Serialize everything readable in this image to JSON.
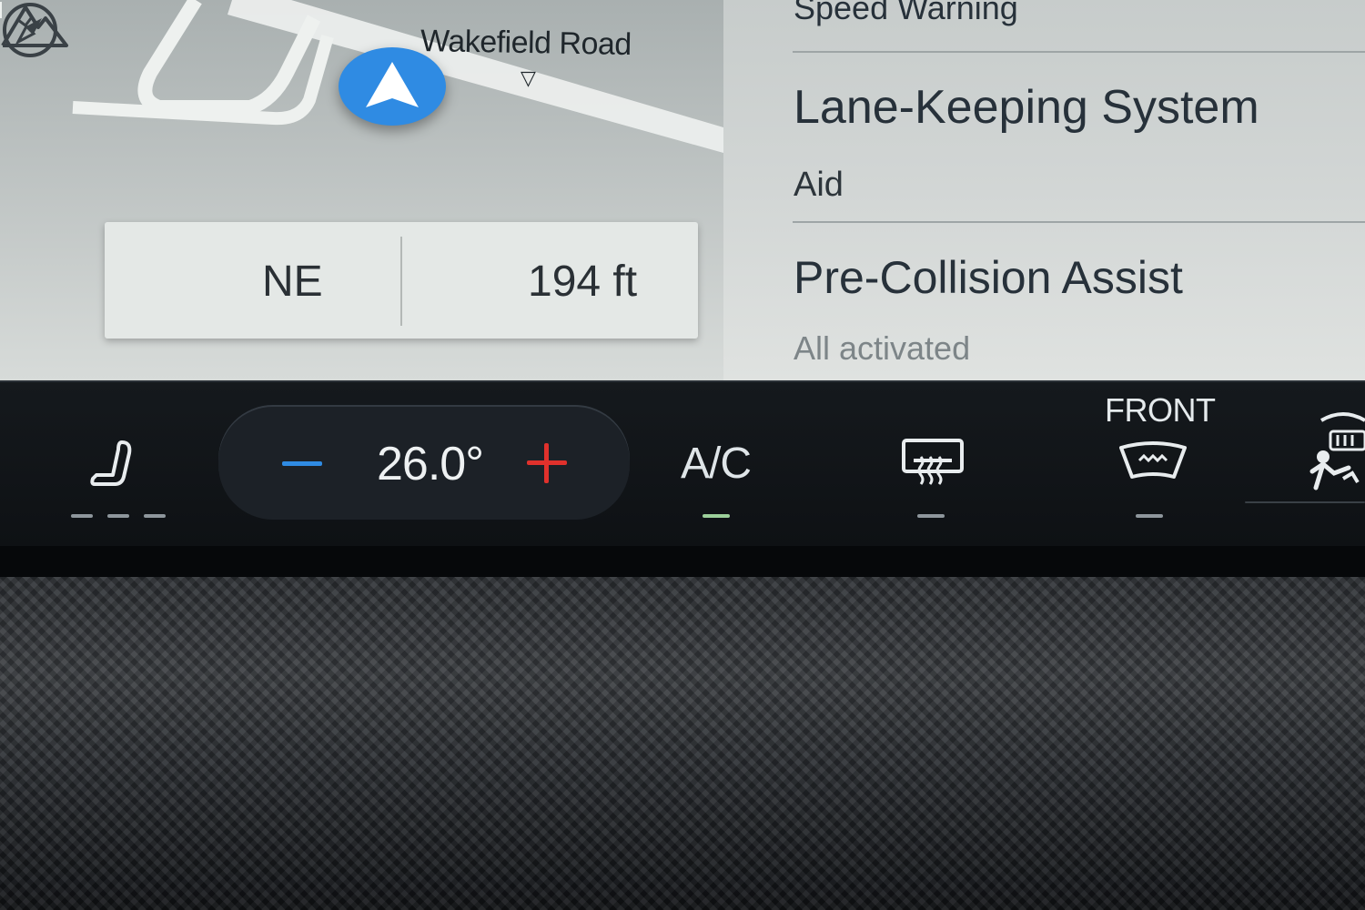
{
  "map": {
    "street_name": "Wakefield Road",
    "street_pointer": "▽",
    "heading": "NE",
    "elevation": "194 ft"
  },
  "settings": {
    "items": [
      {
        "title": "Speed Warning",
        "subtitle": ""
      },
      {
        "title": "Lane-Keeping System",
        "subtitle": "Aid"
      },
      {
        "title": "Pre-Collision Assist",
        "subtitle": "All activated"
      }
    ]
  },
  "climate": {
    "decrease_symbol": "−",
    "temperature": "26.0°",
    "increase_symbol": "+",
    "ac_label": "A/C",
    "front_label": "FRONT",
    "colors": {
      "decrease": "#2f8be3",
      "increase": "#e0312c",
      "ac_indicator": "#9ccf9a",
      "indicator_off": "#8e969c"
    }
  },
  "icons": [
    "seat-heat-icon",
    "compass-icon",
    "mountain-elevation-icon",
    "rear-defrost-icon",
    "front-defrost-icon",
    "auto-climate-icon",
    "navigation-arrow-icon"
  ]
}
